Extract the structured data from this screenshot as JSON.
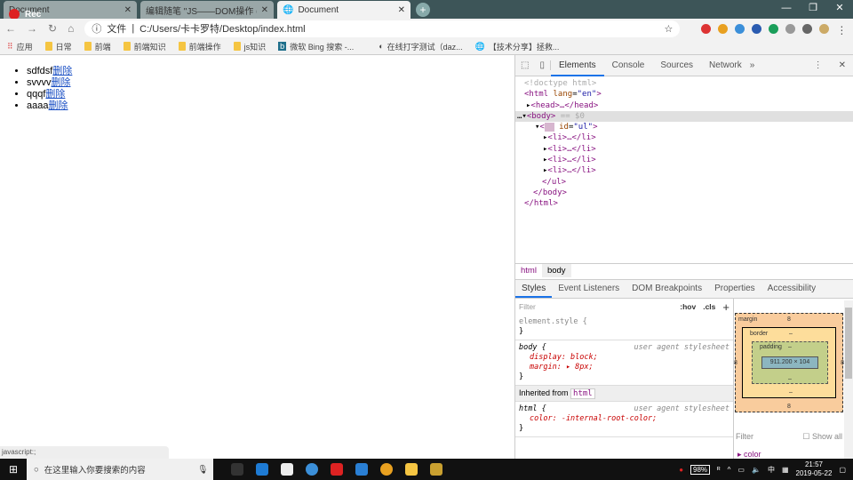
{
  "browser": {
    "tabs": [
      {
        "title": "Document"
      },
      {
        "title": "编辑随笔 \"JS——DOM操作 (c"
      },
      {
        "title": "Document"
      }
    ],
    "recording_label": "Rec",
    "address_prefix": "文件",
    "url": "C:/Users/卡卡罗特/Desktop/index.html",
    "bookmarks": [
      "应用",
      "日常",
      "前端",
      "前端知识",
      "前端操作",
      "js知识",
      "微软 Bing 搜索 -...",
      "在线打字测试（daz...",
      "【技术分享】拯救..."
    ],
    "status_text": "javascript:;"
  },
  "page": {
    "delete_label": "删除",
    "items": [
      {
        "text": "sdfdsf"
      },
      {
        "text": "svvvv"
      },
      {
        "text": "qqqf"
      },
      {
        "text": "aaaa"
      }
    ]
  },
  "devtools": {
    "tabs": [
      "Elements",
      "Console",
      "Sources",
      "Network"
    ],
    "dom": {
      "doctype": "<!doctype html>",
      "html_open": "<html",
      "lang_attr": "lang",
      "lang_val": "\"en\"",
      "head": "<head>…</head>",
      "body": "<body>",
      "body_suffix": " == $0",
      "ul_attr": "id",
      "ul_val": "\"ul\"",
      "li": "<li>…</li>",
      "ul_close": "</ul>",
      "body_close": "</body>",
      "html_close": "</html>"
    },
    "crumbs": [
      "html",
      "body"
    ],
    "subtabs": [
      "Styles",
      "Event Listeners",
      "DOM Breakpoints",
      "Properties",
      "Accessibility"
    ],
    "filter_placeholder": "Filter",
    "hov": ":hov",
    "cls": ".cls",
    "plus": "+",
    "element_style": "element.style {",
    "close_brace": "}",
    "body_rule": {
      "selector": "body {",
      "source": "user agent stylesheet",
      "props": [
        "display: block;",
        "margin: ▸ 8px;"
      ]
    },
    "inherited_label": "Inherited from",
    "inherited_tag": "html",
    "html_rule": {
      "selector": "html {",
      "source": "user agent stylesheet",
      "props": [
        "color: -internal-root-color;"
      ]
    },
    "boxmodel": {
      "margin_label": "margin",
      "margin": "8",
      "border_label": "border",
      "border": "–",
      "padding_label": "padding",
      "padding": "–",
      "content": "911.200 × 104",
      "side": "8",
      "dash": "–"
    },
    "computed_filter": "Filter",
    "show_all": "Show all",
    "computed_prop": "▸ color"
  },
  "taskbar": {
    "search_placeholder": "在这里输入你要搜索的内容",
    "battery": "98%",
    "ime": "中",
    "time": "21:57",
    "date": "2019-05-22"
  }
}
